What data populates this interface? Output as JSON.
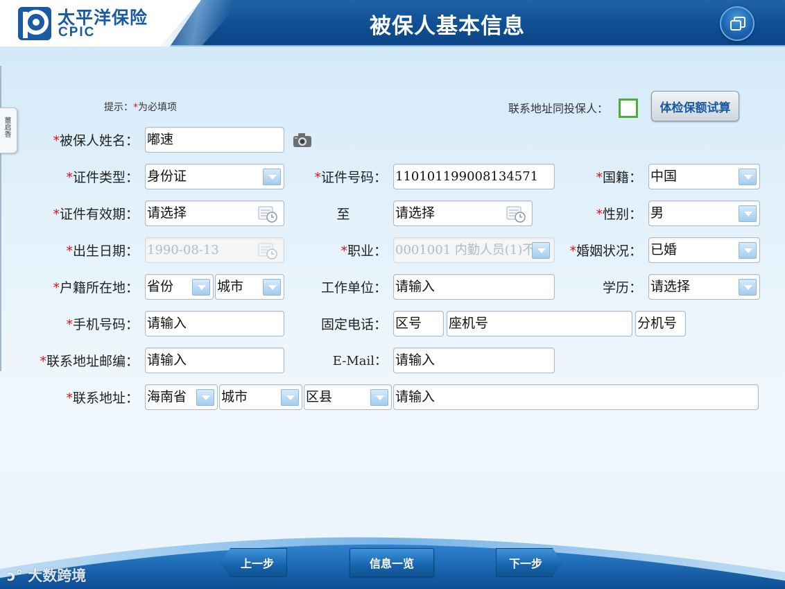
{
  "header": {
    "logo_cn": "太平洋保险",
    "logo_en": "CPIC",
    "title": "被保人基本信息",
    "window_icon": "window-restore-icon"
  },
  "side_tab": {
    "label": "薑启香"
  },
  "hint": {
    "prefix": "提示：",
    "star": "*",
    "text": "为必填项"
  },
  "same_address": {
    "label": "联系地址同投保人：",
    "checked": false
  },
  "calc_button": "体检保额试算",
  "form": {
    "name": {
      "label": "被保人姓名：",
      "value": "嘟速",
      "required": true
    },
    "id_type": {
      "label": "证件类型：",
      "value": "身份证",
      "required": true
    },
    "id_number": {
      "label": "证件号码：",
      "value": "110101199008134571",
      "required": true
    },
    "nationality": {
      "label": "国籍：",
      "value": "中国",
      "required": true
    },
    "id_valid": {
      "label": "证件有效期：",
      "value": "请选择",
      "required": true
    },
    "to_label": "至",
    "id_valid_end": {
      "value": "请选择"
    },
    "gender": {
      "label": "性别：",
      "value": "男",
      "required": true
    },
    "birth": {
      "label": "出生日期：",
      "value": "1990-08-13",
      "required": true
    },
    "occupation": {
      "label": "职业：",
      "value": "0001001 内勤人员(1)不",
      "required": true
    },
    "marital": {
      "label": "婚姻状况：",
      "value": "已婚",
      "required": true
    },
    "domicile": {
      "label": "户籍所在地：",
      "province": "省份",
      "city": "城市",
      "required": true
    },
    "employer": {
      "label": "工作单位：",
      "value": "请输入"
    },
    "education": {
      "label": "学历：",
      "value": "请选择"
    },
    "mobile": {
      "label": "手机号码：",
      "value": "请输入",
      "required": true
    },
    "phone": {
      "label": "固定电话：",
      "area": "区号",
      "number": "座机号",
      "ext": "分机号"
    },
    "zip": {
      "label": "联系地址邮编：",
      "value": "请输入",
      "required": true
    },
    "email": {
      "label": "E-Mail：",
      "value": "请输入"
    },
    "address": {
      "label": "联系地址：",
      "province": "海南省",
      "city": "城市",
      "district": "区县",
      "detail": "请输入",
      "required": true
    }
  },
  "footer": {
    "prev": "上一步",
    "info": "信息一览",
    "next": "下一步",
    "watermark": "大数跨境"
  },
  "colors": {
    "brand_blue": "#1a5aa5",
    "header_blue": "#0f4f93",
    "required_red": "#d4121b",
    "checkbox_green": "#4caf3c"
  }
}
